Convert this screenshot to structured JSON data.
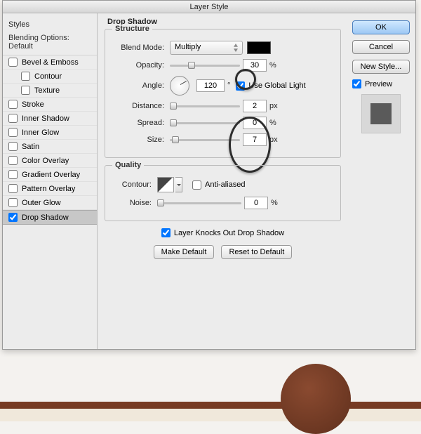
{
  "title": "Layer Style",
  "left": {
    "styles_header": "Styles",
    "blending_default": "Blending Options: Default",
    "items": [
      {
        "label": "Bevel & Emboss",
        "checked": false,
        "indent": false
      },
      {
        "label": "Contour",
        "checked": false,
        "indent": true
      },
      {
        "label": "Texture",
        "checked": false,
        "indent": true
      },
      {
        "label": "Stroke",
        "checked": false,
        "indent": false
      },
      {
        "label": "Inner Shadow",
        "checked": false,
        "indent": false
      },
      {
        "label": "Inner Glow",
        "checked": false,
        "indent": false
      },
      {
        "label": "Satin",
        "checked": false,
        "indent": false
      },
      {
        "label": "Color Overlay",
        "checked": false,
        "indent": false
      },
      {
        "label": "Gradient Overlay",
        "checked": false,
        "indent": false
      },
      {
        "label": "Pattern Overlay",
        "checked": false,
        "indent": false
      },
      {
        "label": "Outer Glow",
        "checked": false,
        "indent": false
      },
      {
        "label": "Drop Shadow",
        "checked": true,
        "indent": false,
        "active": true
      }
    ]
  },
  "panel": {
    "title": "Drop Shadow",
    "structure": {
      "legend": "Structure",
      "blend_mode_label": "Blend Mode:",
      "blend_mode_value": "Multiply",
      "color": "#000000",
      "opacity_label": "Opacity:",
      "opacity_value": "30",
      "opacity_unit": "%",
      "angle_label": "Angle:",
      "angle_value": "120",
      "angle_unit": "°",
      "global_light_label": "Use Global Light",
      "global_light_checked": true,
      "distance_label": "Distance:",
      "distance_value": "2",
      "distance_unit": "px",
      "spread_label": "Spread:",
      "spread_value": "0",
      "spread_unit": "%",
      "size_label": "Size:",
      "size_value": "7",
      "size_unit": "px"
    },
    "quality": {
      "legend": "Quality",
      "contour_label": "Contour:",
      "anti_aliased_label": "Anti-aliased",
      "anti_aliased_checked": false,
      "noise_label": "Noise:",
      "noise_value": "0",
      "noise_unit": "%"
    },
    "knockout_label": "Layer Knocks Out Drop Shadow",
    "knockout_checked": true,
    "make_default": "Make Default",
    "reset_default": "Reset to Default"
  },
  "right": {
    "ok": "OK",
    "cancel": "Cancel",
    "new_style": "New Style...",
    "preview_label": "Preview",
    "preview_checked": true
  }
}
